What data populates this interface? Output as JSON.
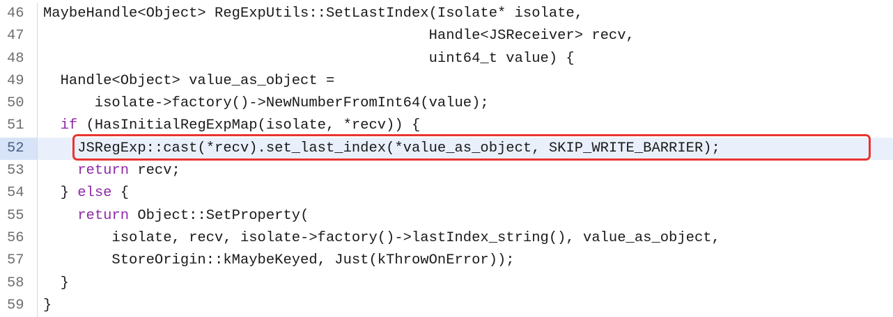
{
  "code_viewer": {
    "lines": [
      {
        "number": "46",
        "text": "MaybeHandle<Object> RegExpUtils::SetLastIndex(Isolate* isolate,"
      },
      {
        "number": "47",
        "text": "                                             Handle<JSReceiver> recv,"
      },
      {
        "number": "48",
        "text": "                                             uint64_t value) {"
      },
      {
        "number": "49",
        "text": "  Handle<Object> value_as_object ="
      },
      {
        "number": "50",
        "text": "      isolate->factory()->NewNumberFromInt64(value);"
      },
      {
        "number": "51",
        "pre": "  ",
        "kw": "if",
        "text": " (HasInitialRegExpMap(isolate, *recv)) {"
      },
      {
        "number": "52",
        "text": "    JSRegExp::cast(*recv).set_last_index(*value_as_object, SKIP_WRITE_BARRIER);"
      },
      {
        "number": "53",
        "pre": "    ",
        "kw": "return",
        "text": " recv;"
      },
      {
        "number": "54",
        "pre": "  } ",
        "kw": "else",
        "text": " {"
      },
      {
        "number": "55",
        "pre": "    ",
        "kw": "return",
        "text": " Object::SetProperty("
      },
      {
        "number": "56",
        "text": "        isolate, recv, isolate->factory()->lastIndex_string(), value_as_object,"
      },
      {
        "number": "57",
        "text": "        StoreOrigin::kMaybeKeyed, Just(kThrowOnError));"
      },
      {
        "number": "58",
        "text": "  }"
      },
      {
        "number": "59",
        "text": "}"
      }
    ]
  },
  "colors": {
    "keyword": "#8e2aa8",
    "highlight_border": "#e8342f",
    "active_line_bg": "#e9f0fb"
  }
}
